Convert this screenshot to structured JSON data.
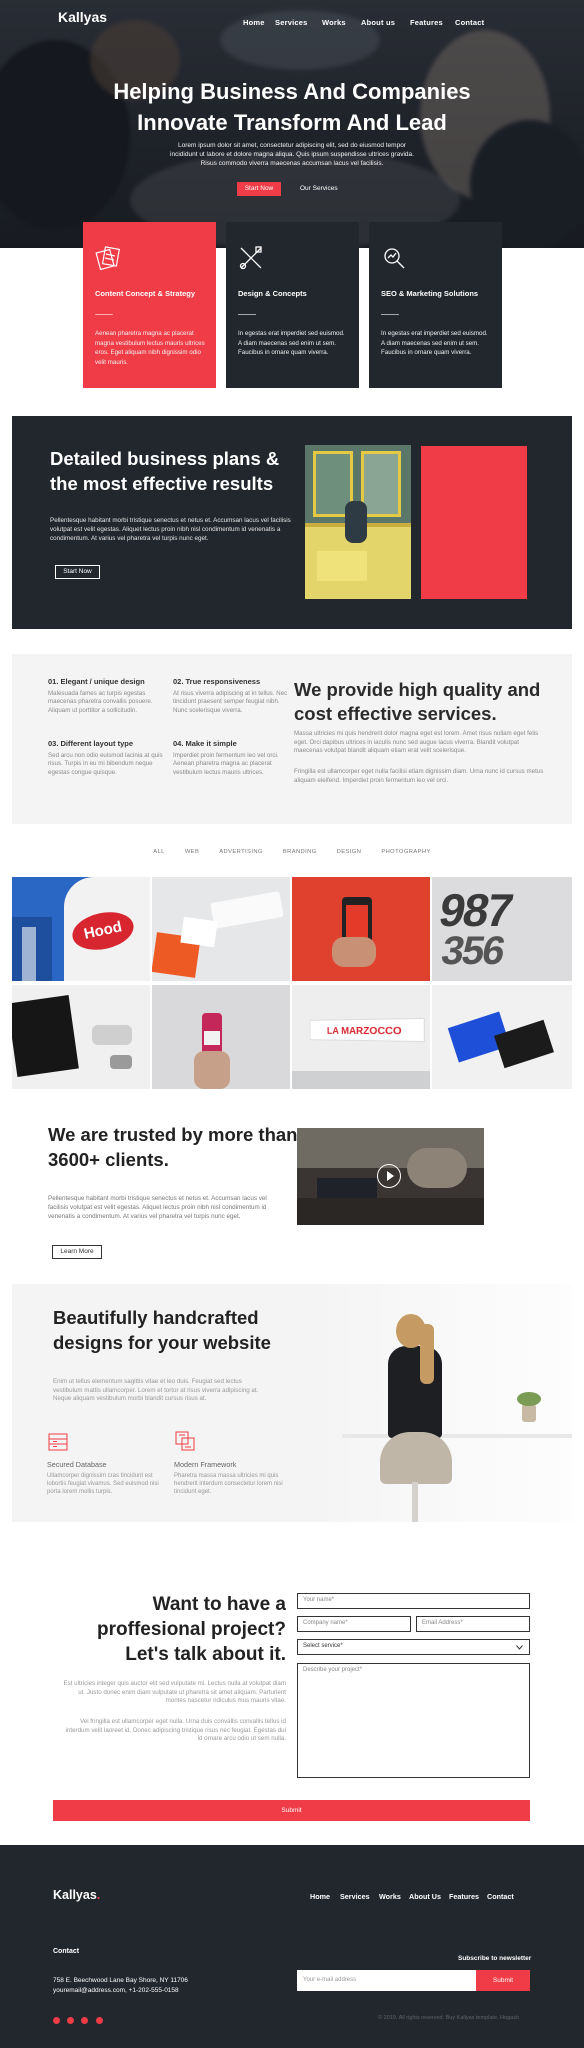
{
  "header": {
    "logo": "Kallyas",
    "nav": [
      "Home",
      "Services",
      "Works",
      "About us",
      "Features",
      "Contact"
    ]
  },
  "hero": {
    "title": "Helping Business And Companies Innovate Transform And Lead",
    "text": "Lorem ipsum dolor sit amet, consectetur adipiscing elit, sed do eiusmod tempor incididunt ut labore et dolore magna aliqua. Quis ipsum suspendisse ultrices gravida. Risus commodo viverra maecenas accumsan lacus vel facilisis.",
    "primary_button": "Start Now",
    "secondary_link": "Our Services"
  },
  "cards": [
    {
      "title": "Content Concept & Strategy",
      "text": "Aenean pharetra magna ac placerat magna vestibulum lectus mauris ultrices eros. Eget aliquam nibh dignissim odio velit mauris.",
      "icon": "strategy-icon",
      "color": "#ef3c46"
    },
    {
      "title": "Design & Concepts",
      "text": "In egestas erat imperdiet sed euismod. A diam maecenas sed enim ut sem. Faucibus in ornare quam viverra.",
      "icon": "design-tools-icon",
      "color": "#22272d"
    },
    {
      "title": "SEO & Marketing Solutions",
      "text": "In egestas erat imperdiet sed euismod. A diam maecenas sed enim ut sem. Faucibus in ornare quam viverra.",
      "icon": "seo-search-icon",
      "color": "#22272d"
    }
  ],
  "plans": {
    "title": "Detailed business plans & the most effective results",
    "text": "Pellentesque habitant morbi tristique senectus et netus et. Accumsan lacus vel facilisis volutpat est velit egestas. Aliquet lectus proin nibh nisl condimentum id venenatis a condimentum. At varius vel pharetra vel turpis nunc eget.",
    "button": "Start Now"
  },
  "features": {
    "items": [
      {
        "title": "01. Elegant / unique design",
        "text": "Malesuada fames ac turpis egestas maecenas pharetra convallis posuere. Aliquam ut porttitor a sollicitudin."
      },
      {
        "title": "02. True responsiveness",
        "text": "At risus viverra adipiscing at in tellus. Nec tincidunt praesent semper feugiat nibh. Nunc scelerisque viverra."
      },
      {
        "title": "03. Different layout type",
        "text": "Sed arcu non odio euismod lacinia at quis risus. Turpis in eu mi bibendum neque egestas congue quisque."
      },
      {
        "title": "04. Make it simple",
        "text": "Imperdiet proin fermentum leo vel orci. Aenean pharetra magna ac placerat vestibulum lectus mauris ultrices."
      }
    ],
    "heading": "We provide high quality and cost effective services.",
    "para1": "Massa ultricies mi quis hendrerit dolor magna eget est lorem. Amet risus nullam eget felis eget. Orci dapibus ultrices in iaculis nunc sed augue lacus viverra. Blandit volutpat maecenas volutpat blandit aliquam etiam erat velit scelerisque.",
    "para2": "Fringilla est ullamcorper eget nulla facilisi etiam dignissim diam. Urna nunc id cursus metus aliquam eleifend. Imperdiet proin fermentum leo vel orci."
  },
  "portfolio": {
    "filters": [
      "ALL",
      "WEB",
      "ADVERTISING",
      "BRANDING",
      "DESIGN",
      "PHOTOGRAPHY"
    ],
    "tile_texts": {
      "hood": "Hood",
      "lamarzocco": "LA MARZOCCO"
    }
  },
  "trusted": {
    "title": "We are trusted by more than 3600+ clients.",
    "text": "Pellentesque habitant morbi tristique senectus et netus et. Accumsan lacus vel facilisis volutpat est velit egestas. Aliquet lectus proin nibh nisl condimentum id venenatis a condimentum. At varius vel pharetra vel turpis nunc eget.",
    "button": "Learn More"
  },
  "handcrafted": {
    "title": "Beautifully handcrafted designs for your website",
    "text": "Enim ut tellus elementum sagittis vitae et leo duis. Feugiat sed lectus vestibulum mattis ullamcorper. Lorem et tortor at risus viverra adipiscing at. Neque aliquam vestibulum morbi blandit cursus risus at.",
    "items": [
      {
        "title": "Secured Database",
        "text": "Ullamcorper dignissim cras tincidunt est lobortis feugiat vivamus. Sed euismod nisi porta lorem mollis turpis.",
        "icon": "database-icon"
      },
      {
        "title": "Modern Framework",
        "text": "Pharetra massa massa ultricies mi quis hendrerit interdum consectetur lorem nisi tincidunt eget.",
        "icon": "framework-icon"
      }
    ]
  },
  "contact": {
    "title": "Want to have a proffesional project? Let's talk about it.",
    "para1": "Est ultricies integer quis auctor elit sed vulputate mi. Lectus nulla at volutpat diam ut. Justo donec enim diam vulputate ut pharetra sit amet aliquam. Parturient montes nascetur ridiculus mus mauris vitae.",
    "para2": "Vel fringilla est ullamcorper eget nulla. Urna duis convallis convallis tellus id interdum velit laoreet id. Donec adipiscing tristique risus nec feugiat. Egestas dui id ornare arcu odio ut sem nulla.",
    "fields": {
      "name": "Your name*",
      "company": "Company name*",
      "email": "Email Address*",
      "service": "Select service*",
      "project": "Describe your project*"
    },
    "submit": "Submit"
  },
  "footer": {
    "logo": "Kallyas",
    "nav": [
      "Home",
      "Services",
      "Works",
      "About Us",
      "Features",
      "Contact"
    ],
    "contact_heading": "Contact",
    "address": "758 E. Beechwood Lane Bay Shore, NY 11706",
    "email_phone": "youremail@address.com, +1-202-555-0158",
    "newsletter_heading": "Subscribe to newsletter",
    "newsletter_placeholder": "Your e-mail address",
    "newsletter_button": "Submit",
    "copyright": "© 2019. All rights reserved. Buy Kallyas template. Hogash"
  },
  "colors": {
    "accent": "#ef3c46",
    "dark": "#22272d",
    "light_bg": "#f4f4f4"
  }
}
